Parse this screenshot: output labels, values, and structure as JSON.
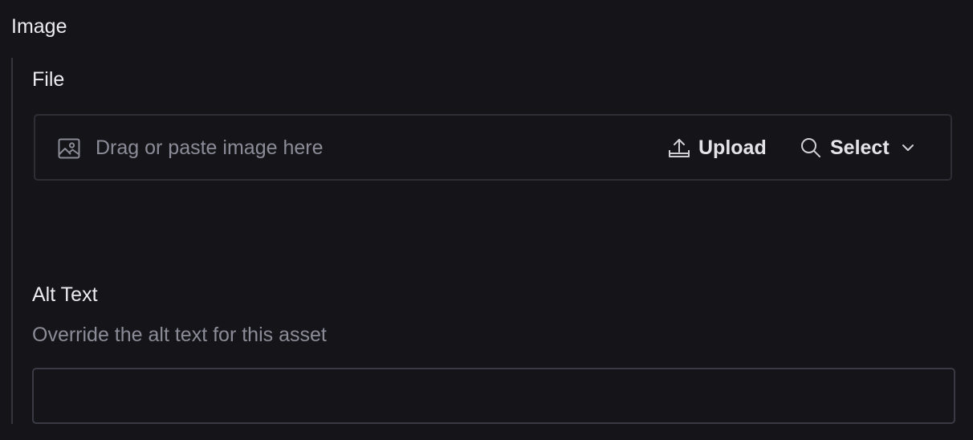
{
  "section": {
    "title": "Image"
  },
  "file": {
    "label": "File",
    "dropzone_text": "Drag or paste image here",
    "upload_label": "Upload",
    "select_label": "Select",
    "icons": {
      "image": "image-icon",
      "upload": "upload-icon",
      "search": "search-icon",
      "chevron": "chevron-down-icon"
    }
  },
  "alt_text": {
    "label": "Alt Text",
    "description": "Override the alt text for this asset",
    "value": "",
    "placeholder": ""
  },
  "colors": {
    "background": "#141419",
    "border": "#2e2e37",
    "text": "#ececef",
    "muted": "#8c8c98"
  }
}
